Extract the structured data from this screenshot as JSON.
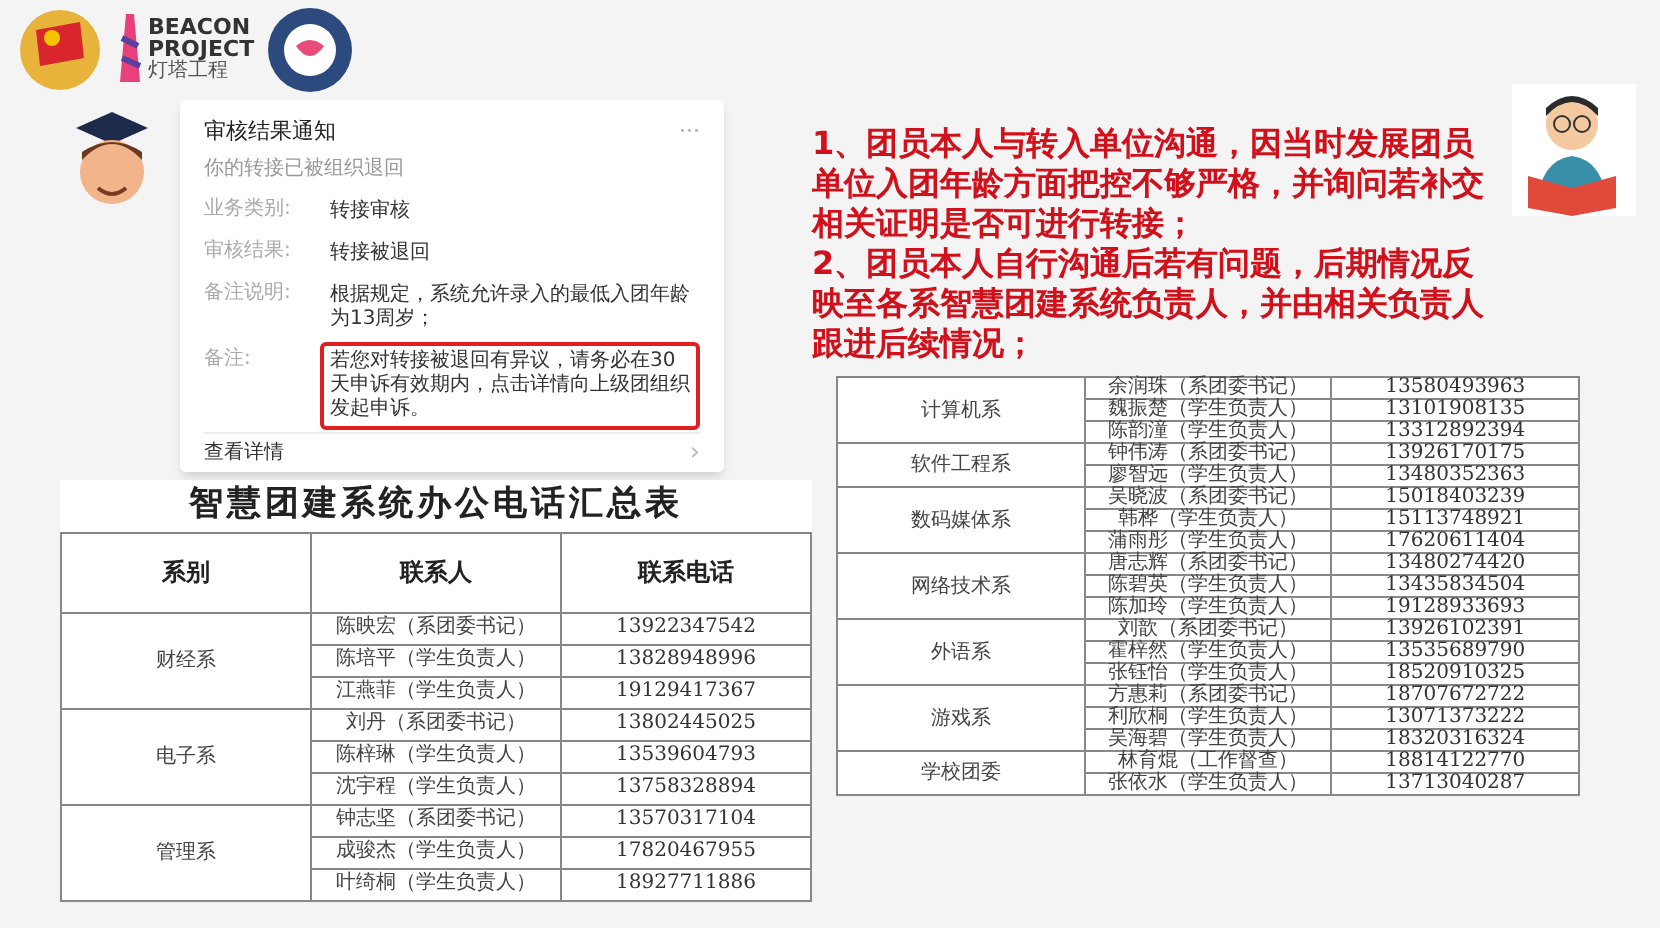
{
  "logos": {
    "beacon_line1": "BEACON",
    "beacon_line2": "PROJECT",
    "beacon_sub": "灯塔工程"
  },
  "notice": {
    "title": "审核结果通知",
    "menu": "···",
    "subtitle": "你的转接已被组织退回",
    "rows": [
      {
        "label": "业务类别:",
        "value": "转接审核",
        "highlighted": false
      },
      {
        "label": "审核结果:",
        "value": "转接被退回",
        "highlighted": false
      },
      {
        "label": "备注说明:",
        "value": "根据规定，系统允许录入的最低入团年龄为13周岁；",
        "highlighted": false
      },
      {
        "label": "备注:",
        "value": "若您对转接被退回有异议，请务必在30天申诉有效期内，点击详情向上级团组织发起申诉。",
        "highlighted": true
      }
    ],
    "footer": "查看详情",
    "chevron": "›"
  },
  "notes": [
    "1、团员本人与转入单位沟通，因当时发展团员单位入团年龄方面把控不够严格，并询问若补交相关证明是否可进行转接；",
    "2、团员本人自行沟通后若有问题，后期情况反映至各系智慧团建系统负责人，并由相关负责人跟进后续情况；"
  ],
  "table_left": {
    "title": "智慧团建系统办公电话汇总表",
    "columns": [
      "系别",
      "联系人",
      "联系电话"
    ],
    "groups": [
      {
        "department": "财经系",
        "contacts": [
          {
            "name": "陈映宏（系团委书记）",
            "phone": "13922347542"
          },
          {
            "name": "陈培平（学生负责人）",
            "phone": "13828948996"
          },
          {
            "name": "江燕菲（学生负责人）",
            "phone": "19129417367"
          }
        ]
      },
      {
        "department": "电子系",
        "contacts": [
          {
            "name": "刘丹（系团委书记）",
            "phone": "13802445025"
          },
          {
            "name": "陈梓琳（学生负责人）",
            "phone": "13539604793"
          },
          {
            "name": "沈宇程（学生负责人）",
            "phone": "13758328894"
          }
        ]
      },
      {
        "department": "管理系",
        "contacts": [
          {
            "name": "钟志坚（系团委书记）",
            "phone": "13570317104"
          },
          {
            "name": "成骏杰（学生负责人）",
            "phone": "17820467955"
          },
          {
            "name": "叶绮桐（学生负责人）",
            "phone": "18927711886"
          }
        ]
      }
    ]
  },
  "table_right": {
    "groups": [
      {
        "department": "计算机系",
        "contacts": [
          {
            "name": "余润珠（系团委书记）",
            "phone": "13580493963"
          },
          {
            "name": "魏振楚（学生负责人）",
            "phone": "13101908135"
          },
          {
            "name": "陈韵潼（学生负责人）",
            "phone": "13312892394"
          }
        ]
      },
      {
        "department": "软件工程系",
        "contacts": [
          {
            "name": "钟伟涛（系团委书记）",
            "phone": "13926170175"
          },
          {
            "name": "廖智远（学生负责人）",
            "phone": "13480352363"
          }
        ]
      },
      {
        "department": "数码媒体系",
        "contacts": [
          {
            "name": "吴晓波（系团委书记）",
            "phone": "15018403239"
          },
          {
            "name": "韩桦（学生负责人）",
            "phone": "15113748921"
          },
          {
            "name": "蒲雨彤（学生负责人）",
            "phone": "17620611404"
          }
        ]
      },
      {
        "department": "网络技术系",
        "contacts": [
          {
            "name": "唐志辉（系团委书记）",
            "phone": "13480274420"
          },
          {
            "name": "陈碧英（学生负责人）",
            "phone": "13435834504"
          },
          {
            "name": "陈加玲（学生负责人）",
            "phone": "19128933693"
          }
        ]
      },
      {
        "department": "外语系",
        "contacts": [
          {
            "name": "刘歆（系团委书记）",
            "phone": "13926102391"
          },
          {
            "name": "霍梓然（学生负责人）",
            "phone": "13535689790"
          },
          {
            "name": "张钰怡（学生负责人）",
            "phone": "18520910325"
          }
        ]
      },
      {
        "department": "游戏系",
        "contacts": [
          {
            "name": "方惠莉（系团委书记）",
            "phone": "18707672722"
          },
          {
            "name": "利欣桐（学生负责人）",
            "phone": "13071373222"
          },
          {
            "name": "吴海碧（学生负责人）",
            "phone": "18320316324"
          }
        ]
      },
      {
        "department": "学校团委",
        "contacts": [
          {
            "name": "林育焜（工作督查）",
            "phone": "18814122770"
          },
          {
            "name": "张依水（学生负责人）",
            "phone": "13713040287"
          }
        ]
      }
    ]
  }
}
